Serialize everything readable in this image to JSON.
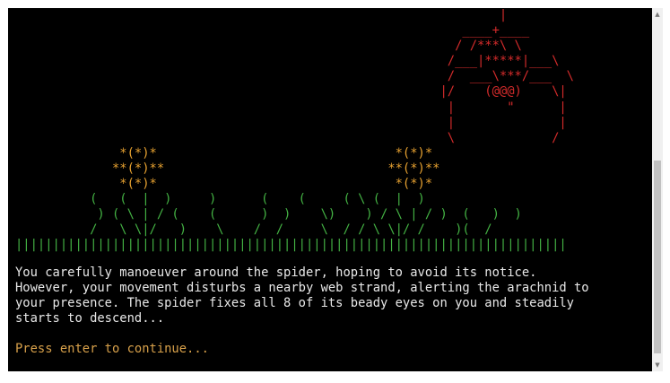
{
  "scene": {
    "spider_art": [
      "                                                                 |",
      "                                                            ____+____",
      "                                                           / /***\\ \\",
      "                                                          /___|*****|___\\",
      "                                                          /  ___\\***/___  \\",
      "                                                         |/    (@@@)    \\|",
      "                                                          |       \"      |",
      "                                                          |              |",
      "                                                          \\             /"
    ],
    "flowers_art": [
      "              *(*)*                                *(*)*",
      "             **(*)**                              **(*)**",
      "              *(*)*                                *(*)*"
    ],
    "grass_art": [
      "          (   (  |  )     )      (    (     ( \\ (  |  )",
      "           ) ( \\ | / (    (      )  )    \\)    ) / \\ | / )  (   )  )",
      "          /   \\ \\|/   )    \\    /  /     \\  / / \\ \\|/ /    )(  /",
      "||||||||||||||||||||||||||||||||||||||||||||||||||||||||||||||||||||||||||"
    ]
  },
  "story": {
    "lines": [
      "You carefully manoeuver around the spider, hoping to avoid its notice.",
      "However, your movement disturbs a nearby web strand, alerting the arachnid to",
      "your presence. The spider fixes all 8 of its beady eyes on you and steadily",
      "starts to descend..."
    ]
  },
  "prompt": {
    "text": "Press enter to continue..."
  },
  "colors": {
    "spider": "#d42b2b",
    "flowers": "#e5a030",
    "grass": "#44b344",
    "story_text": "#e8e8e8",
    "prompt_text": "#d7a04a",
    "background": "#000000"
  },
  "scrollbar": {
    "up_icon": "triangle-up-icon",
    "down_icon": "triangle-down-icon"
  }
}
